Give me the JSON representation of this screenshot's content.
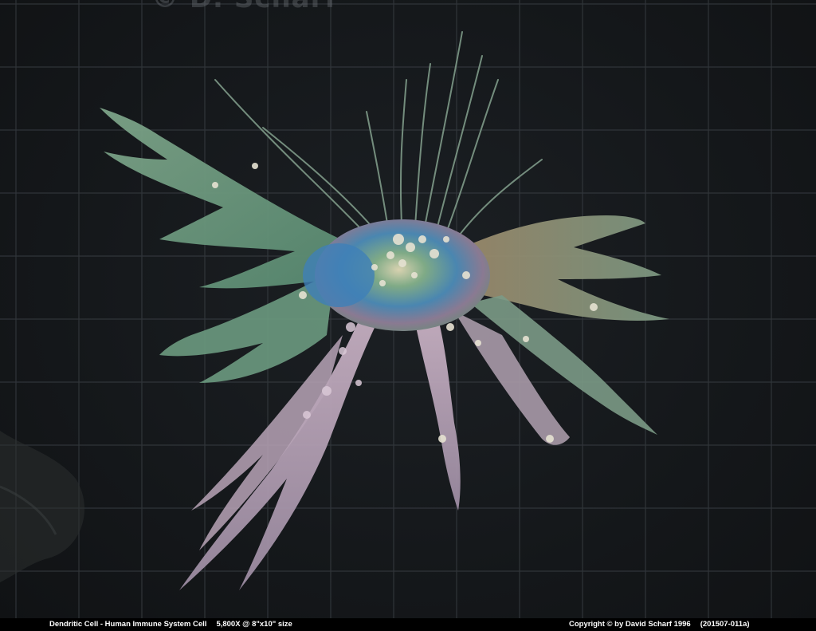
{
  "watermark": "© D. Scharf",
  "caption": {
    "title": "Dendritic Cell - Human Immune System Cell",
    "magnification": "5,800X @ 8\"x10\" size",
    "copyright": "Copyright © by David Scharf 1996",
    "image_id": "(201507-011a)"
  },
  "colors": {
    "background": "#15181b",
    "grid": "#3a3f44",
    "cell_green": "#6f9e7a",
    "cell_blue": "#3f7fb8",
    "cell_pink": "#c9a7b8",
    "caption_bar": "#000000"
  }
}
